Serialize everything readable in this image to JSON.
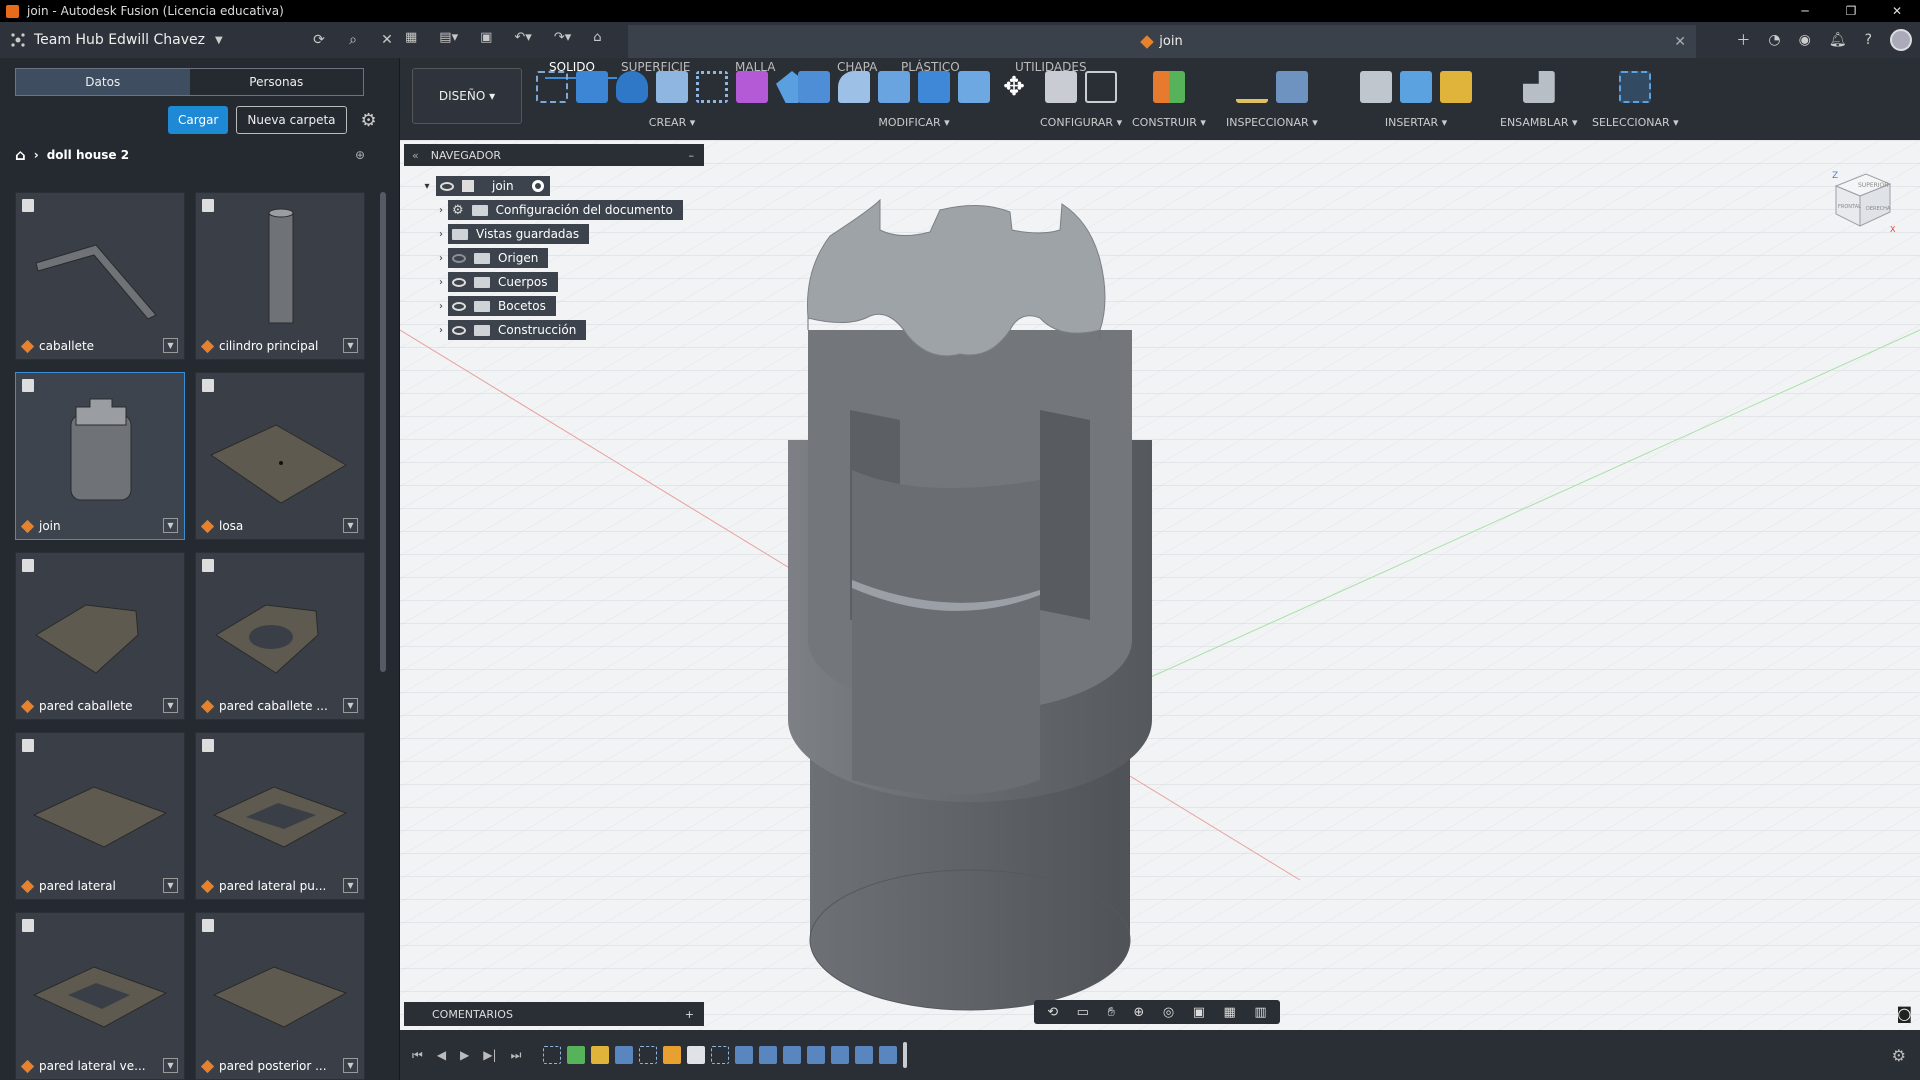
{
  "window": {
    "title": "join - Autodesk Fusion (Licencia educativa)",
    "controls": [
      "─",
      "❐",
      "✕"
    ]
  },
  "header": {
    "team_name": "Team Hub Edwill Chavez",
    "document_tab": "join"
  },
  "data_panel": {
    "tabs": [
      "Datos",
      "Personas"
    ],
    "upload_label": "Cargar",
    "new_folder_label": "Nueva carpeta",
    "breadcrumb": "doll house 2",
    "files": [
      {
        "name": "caballete",
        "thumb": "beam"
      },
      {
        "name": "cilindro principal",
        "thumb": "cylinder"
      },
      {
        "name": "join",
        "thumb": "join",
        "selected": true
      },
      {
        "name": "losa",
        "thumb": "slab"
      },
      {
        "name": "pared caballete",
        "thumb": "pentagon"
      },
      {
        "name": "pared caballete ...",
        "thumb": "pentagon-hole"
      },
      {
        "name": "pared lateral",
        "thumb": "plate"
      },
      {
        "name": "pared lateral pu...",
        "thumb": "plate-u"
      },
      {
        "name": "pared lateral ve...",
        "thumb": "plate-window"
      },
      {
        "name": "pared posterior ...",
        "thumb": "plate"
      }
    ]
  },
  "toolbar": {
    "workspace": "DISEÑO ▾",
    "tabs": [
      "SOLIDO",
      "SUPERFICIE",
      "MALLA",
      "CHAPA",
      "PLÁSTICO",
      "UTILIDADES"
    ],
    "active_tab": "SOLIDO",
    "groups": {
      "crear": "CREAR ▾",
      "modificar": "MODIFICAR ▾",
      "configurar": "CONFIGURAR ▾",
      "construir": "CONSTRUIR ▾",
      "inspeccionar": "INSPECCIONAR ▾",
      "insertar": "INSERTAR ▾",
      "ensamblar": "ENSAMBLAR ▾",
      "seleccionar": "SELECCIONAR ▾"
    }
  },
  "navigator": {
    "title": "NAVEGADOR",
    "root": "join",
    "items": [
      "Configuración del documento",
      "Vistas guardadas",
      "Origen",
      "Cuerpos",
      "Bocetos",
      "Construcción"
    ]
  },
  "comments": {
    "title": "COMENTARIOS"
  },
  "viewcube": {
    "top": "SUPERIOR",
    "front": "FRONTAL",
    "right": "DERECHA",
    "axis_z": "Z",
    "axis_x": "X"
  },
  "colors": {
    "accent": "#1e8ad6",
    "brand": "#e8822a",
    "panel": "#252a31",
    "toolbar": "#2a2e35"
  }
}
